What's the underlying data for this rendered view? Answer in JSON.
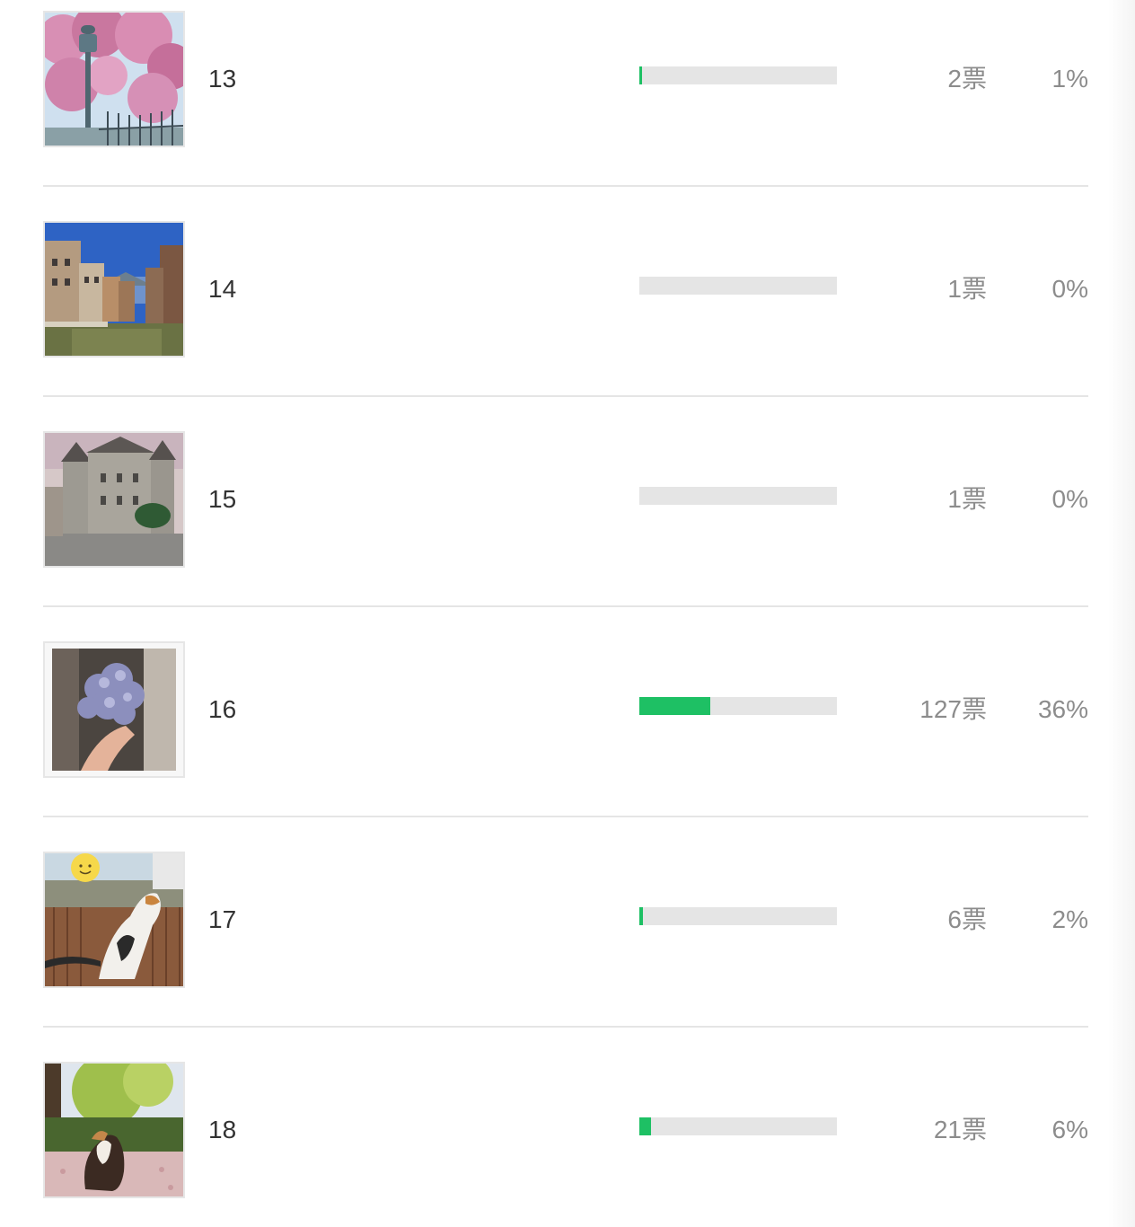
{
  "accent_color": "#1ec064",
  "track_color": "#e5e5e5",
  "options": [
    {
      "number": "13",
      "votes": "2票",
      "percent": "1%",
      "fill": 0.01,
      "thumbnail": "cherry-blossom-lamppost-photo"
    },
    {
      "number": "14",
      "votes": "1票",
      "percent": "0%",
      "fill": 0.0,
      "thumbnail": "canal-town-photo"
    },
    {
      "number": "15",
      "votes": "1票",
      "percent": "0%",
      "fill": 0.0,
      "thumbnail": "castle-photo"
    },
    {
      "number": "16",
      "votes": "127票",
      "percent": "36%",
      "fill": 0.36,
      "thumbnail": "hydrangea-bouquet-photo"
    },
    {
      "number": "17",
      "votes": "6票",
      "percent": "2%",
      "fill": 0.02,
      "thumbnail": "cat-on-balcony-photo"
    },
    {
      "number": "18",
      "votes": "21票",
      "percent": "6%",
      "fill": 0.06,
      "thumbnail": "dog-in-garden-photo"
    }
  ]
}
